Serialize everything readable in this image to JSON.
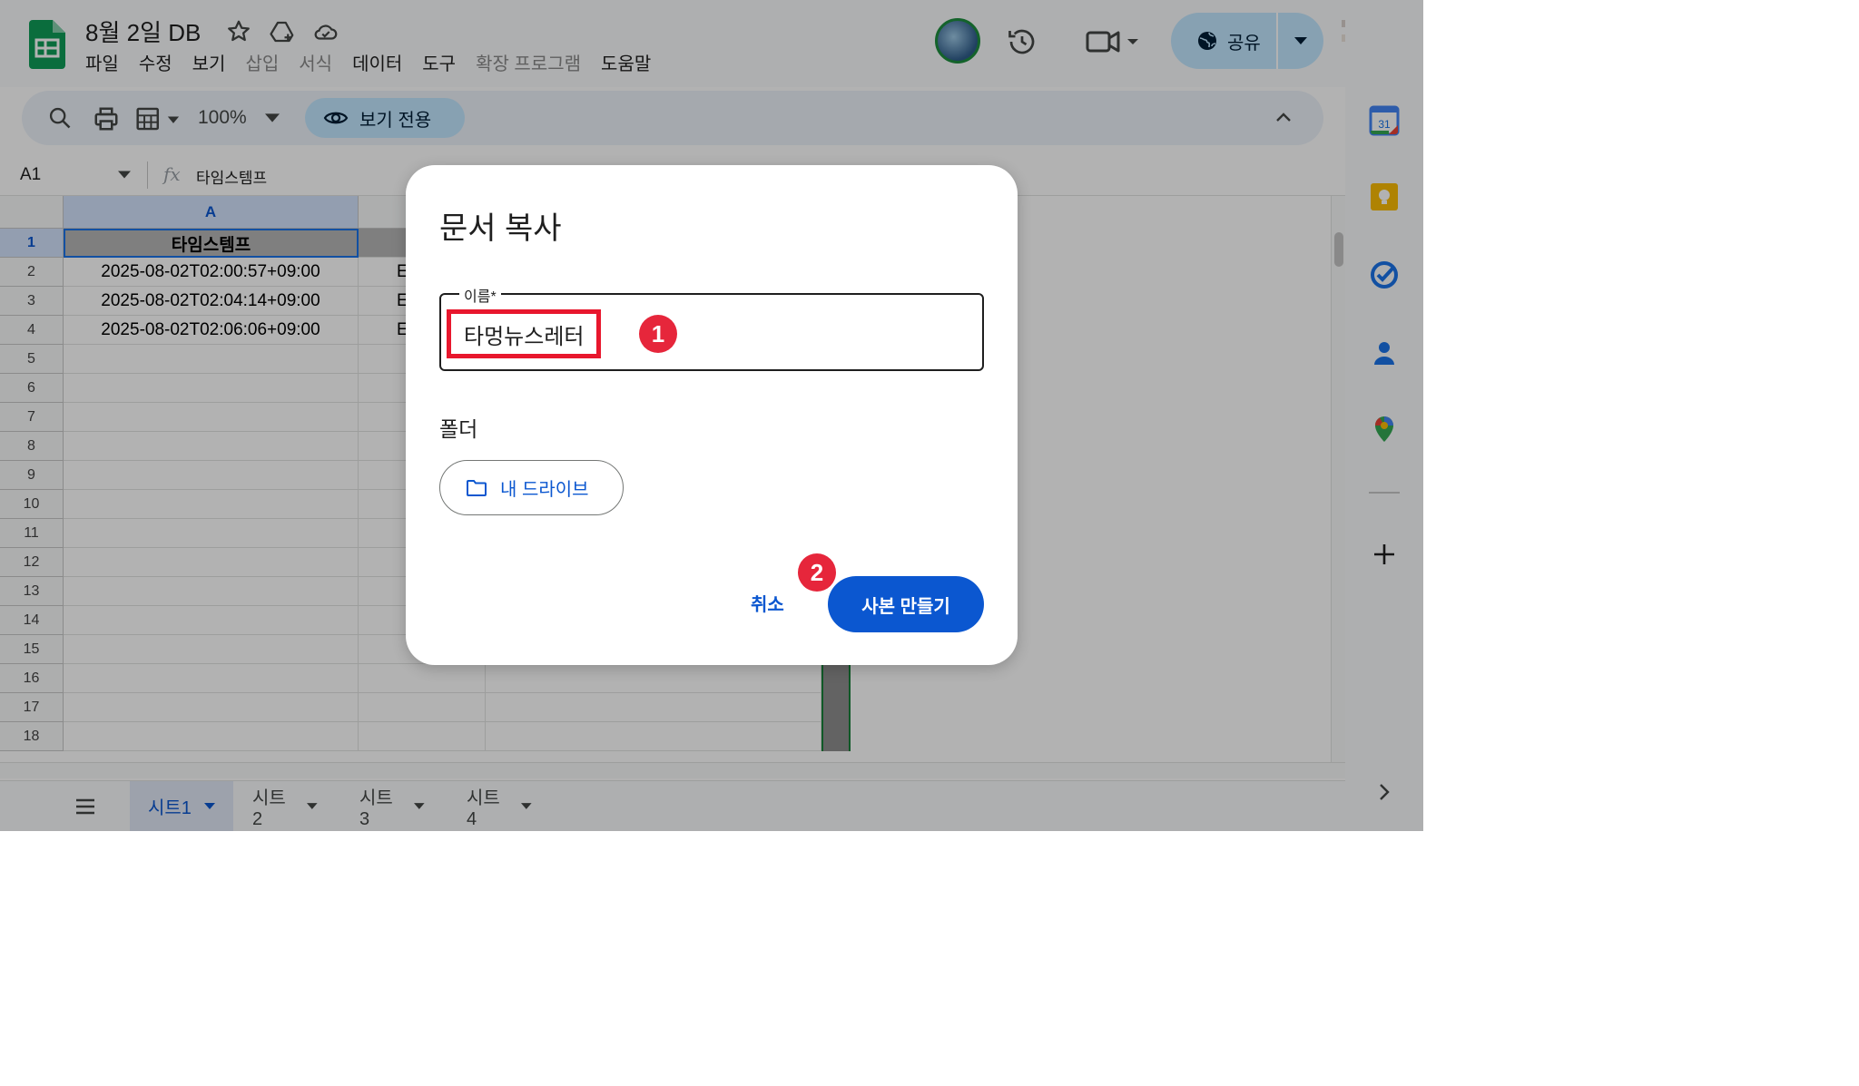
{
  "header": {
    "doc_title": "8월 2일 DB",
    "menu": [
      {
        "label": "파일",
        "disabled": false
      },
      {
        "label": "수정",
        "disabled": false
      },
      {
        "label": "보기",
        "disabled": false
      },
      {
        "label": "삽입",
        "disabled": true
      },
      {
        "label": "서식",
        "disabled": true
      },
      {
        "label": "데이터",
        "disabled": false
      },
      {
        "label": "도구",
        "disabled": false
      },
      {
        "label": "확장 프로그램",
        "disabled": true
      },
      {
        "label": "도움말",
        "disabled": false
      }
    ],
    "share_label": "공유"
  },
  "toolbar": {
    "zoom": "100%",
    "view_only_label": "보기 전용"
  },
  "formula_bar": {
    "cell_ref": "A1",
    "content": "타임스템프"
  },
  "sheet": {
    "column_a_header": "A",
    "rows": [
      {
        "num": "1",
        "a": "타임스템프",
        "b": ""
      },
      {
        "num": "2",
        "a": "2025-08-02T02:00:57+09:00",
        "b": "E"
      },
      {
        "num": "3",
        "a": "2025-08-02T02:04:14+09:00",
        "b": "E"
      },
      {
        "num": "4",
        "a": "2025-08-02T02:06:06+09:00",
        "b": "E"
      },
      {
        "num": "5",
        "a": "",
        "b": ""
      },
      {
        "num": "6",
        "a": "",
        "b": ""
      },
      {
        "num": "7",
        "a": "",
        "b": ""
      },
      {
        "num": "8",
        "a": "",
        "b": ""
      },
      {
        "num": "9",
        "a": "",
        "b": ""
      },
      {
        "num": "10",
        "a": "",
        "b": ""
      },
      {
        "num": "11",
        "a": "",
        "b": ""
      },
      {
        "num": "12",
        "a": "",
        "b": ""
      },
      {
        "num": "13",
        "a": "",
        "b": ""
      },
      {
        "num": "14",
        "a": "",
        "b": ""
      },
      {
        "num": "15",
        "a": "",
        "b": ""
      },
      {
        "num": "16",
        "a": "",
        "b": ""
      },
      {
        "num": "17",
        "a": "",
        "b": ""
      },
      {
        "num": "18",
        "a": "",
        "b": ""
      }
    ]
  },
  "sheet_tabs": [
    {
      "label": "시트1",
      "active": true
    },
    {
      "label": "시트2",
      "active": false
    },
    {
      "label": "시트3",
      "active": false
    },
    {
      "label": "시트4",
      "active": false
    }
  ],
  "side_panel_icons": [
    "calendar-icon",
    "keep-icon",
    "tasks-icon",
    "contacts-icon",
    "maps-icon",
    "add-icon"
  ],
  "calendar_day": "31",
  "dialog": {
    "title": "문서 복사",
    "name_label": "이름*",
    "name_value": "타멍뉴스레터",
    "step1": "1",
    "folder_label": "폴더",
    "folder_button": "내 드라이브",
    "cancel": "취소",
    "make_copy": "사본 만들기",
    "step2": "2"
  },
  "colors": {
    "accent": "#0b57d0",
    "highlight": "#e8172d",
    "step_badge": "#e6263b",
    "share_bg": "#c2e7ff"
  }
}
